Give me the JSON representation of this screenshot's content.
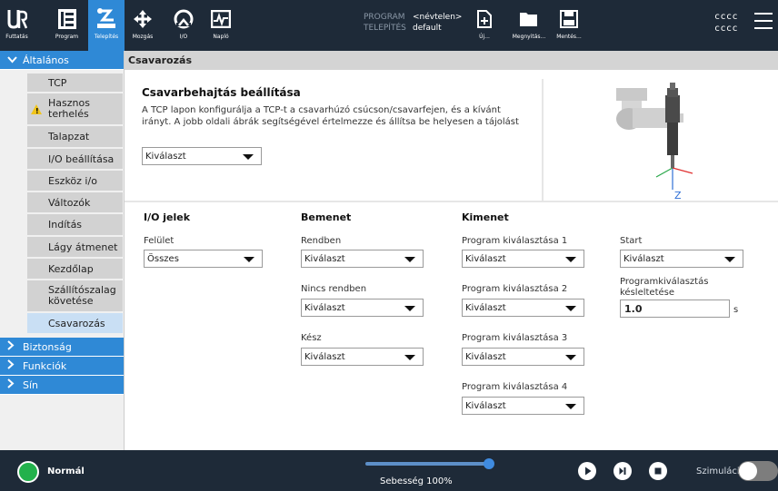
{
  "topbar": {
    "nav": [
      {
        "label": "Futtatás",
        "icon": "ur-logo-icon"
      },
      {
        "label": "Program",
        "icon": "program-icon"
      },
      {
        "label": "Telepítés",
        "icon": "installation-icon",
        "active": true
      }
    ],
    "tools": [
      {
        "label": "Mozgás",
        "icon": "move-icon"
      },
      {
        "label": "I/O",
        "icon": "io-icon"
      },
      {
        "label": "Napló",
        "icon": "log-icon"
      }
    ],
    "program_key": "PROGRAM",
    "program_value": "<névtelen>",
    "installation_key": "TELEPÍTÉS",
    "installation_value": "default",
    "file_actions": [
      {
        "label": "Új...",
        "icon": "new-file-icon"
      },
      {
        "label": "Megnyitás...",
        "icon": "folder-open-icon"
      },
      {
        "label": "Mentés...",
        "icon": "save-icon"
      }
    ],
    "user_line1": "cccc",
    "user_line2": "cccc",
    "menu_icon": "hamburger-menu-icon"
  },
  "sidebar": {
    "general_label": "Általános",
    "items": [
      {
        "label": "TCP",
        "warning": false
      },
      {
        "label": "Hasznos terhelés",
        "warning": true
      },
      {
        "label": "Talapzat",
        "warning": false
      },
      {
        "label": "I/O beállítása",
        "warning": false
      },
      {
        "label": "Eszköz i/o",
        "warning": false
      },
      {
        "label": "Változók",
        "warning": false
      },
      {
        "label": "Indítás",
        "warning": false
      },
      {
        "label": "Lágy átmenet",
        "warning": false
      },
      {
        "label": "Kezdőlap",
        "warning": false
      },
      {
        "label": "Szállítószalag követése",
        "warning": false
      },
      {
        "label": "Csavarozás",
        "warning": false,
        "selected": true
      }
    ],
    "sections": [
      "Biztonság",
      "Funkciók",
      "Sín"
    ]
  },
  "main": {
    "title": "Csavarozás",
    "setup_heading": "Csavarbehajtás beállítása",
    "setup_text_line1": "A TCP lapon konfigurálja a TCP-t a csavarhúzó csúcson/csavarfejen, és a kívánt",
    "setup_text_line2": "irányt. A jobb oldali ábrák segítségével értelmezze és állítsa be helyesen a tájolást",
    "setup_select": "Kiválaszt",
    "diagram_axis_z": "Z",
    "io_heading": "I/O jelek",
    "io_field_label": "Felület",
    "io_field_value": "Összes",
    "input_heading": "Bemenet",
    "inputs": [
      {
        "label": "Rendben",
        "value": "Kiválaszt"
      },
      {
        "label": "Nincs rendben",
        "value": "Kiválaszt"
      },
      {
        "label": "Kész",
        "value": "Kiválaszt"
      }
    ],
    "output_heading": "Kimenet",
    "outputs": [
      {
        "label": "Program kiválasztása 1",
        "value": "Kiválaszt"
      },
      {
        "label": "Program kiválasztása 2",
        "value": "Kiválaszt"
      },
      {
        "label": "Program kiválasztása 3",
        "value": "Kiválaszt"
      },
      {
        "label": "Program kiválasztása 4",
        "value": "Kiválaszt"
      }
    ],
    "start_label": "Start",
    "start_value": "Kiválaszt",
    "delay_label_line1": "Programkiválasztás",
    "delay_label_line2": "késleltetése",
    "delay_value": "1.0",
    "delay_unit": "s"
  },
  "footer": {
    "status": "Normál",
    "speed_label": "Sebesség 100%",
    "speed_percent": 100,
    "simulation_label": "Szimuláció",
    "simulation_on": false
  },
  "colors": {
    "topbar_bg": "#1e2a38",
    "accent": "#2f89d6",
    "status_green": "#22b14c"
  }
}
